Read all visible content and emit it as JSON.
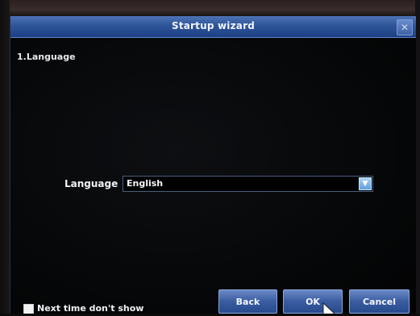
{
  "window": {
    "title": "Startup wizard"
  },
  "step": {
    "title": "1.Language"
  },
  "language": {
    "label": "Language",
    "selected": "English"
  },
  "footer": {
    "checkbox_label": "Next time don't show",
    "checkbox_checked": false,
    "back_label": "Back",
    "ok_label": "OK",
    "cancel_label": "Cancel"
  },
  "icons": {
    "close": "close-icon",
    "dropdown": "chevron-down-icon",
    "cursor": "mouse-pointer-icon"
  },
  "colors": {
    "titlebar": "#2f5599",
    "button": "#3a5ca0",
    "background": "#050506"
  }
}
